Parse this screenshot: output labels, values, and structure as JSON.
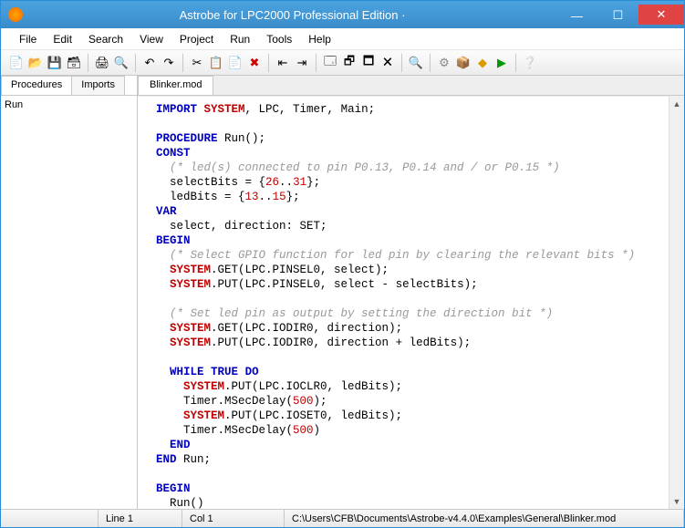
{
  "window": {
    "title": "Astrobe for LPC2000 Professional Edition  ·"
  },
  "menu": [
    "File",
    "Edit",
    "Search",
    "View",
    "Project",
    "Run",
    "Tools",
    "Help"
  ],
  "leftpanel": {
    "tabs": [
      "Procedures",
      "Imports"
    ],
    "items": [
      "Run"
    ]
  },
  "editor": {
    "tab": "Blinker.mod"
  },
  "code": {
    "l1a": "IMPORT",
    "l1b": "SYSTEM",
    "l1c": ", LPC, Timer, Main;",
    "l2a": "PROCEDURE",
    "l2b": " Run();",
    "l3": "CONST",
    "l4": "  (* led(s) connected to pin P0.13, P0.14 and / or P0.15 *)",
    "l5a": "  selectBits = {",
    "l5b": "26",
    "l5c": "..",
    "l5d": "31",
    "l5e": "};",
    "l6a": "  ledBits = {",
    "l6b": "13",
    "l6c": "..",
    "l6d": "15",
    "l6e": "};",
    "l7": "VAR",
    "l8": "  select, direction: SET;",
    "l9": "BEGIN",
    "l10": "  (* Select GPIO function for led pin by clearing the relevant bits *)",
    "l11a": "  ",
    "l11b": "SYSTEM",
    "l11c": ".GET(LPC.PINSEL0, select);",
    "l12a": "  ",
    "l12b": "SYSTEM",
    "l12c": ".PUT(LPC.PINSEL0, select - selectBits);",
    "l13": "  (* Set led pin as output by setting the direction bit *)",
    "l14a": "  ",
    "l14b": "SYSTEM",
    "l14c": ".GET(LPC.IODIR0, direction);",
    "l15a": "  ",
    "l15b": "SYSTEM",
    "l15c": ".PUT(LPC.IODIR0, direction + ledBits);",
    "l16a": "  ",
    "l16b": "WHILE",
    "l16c": " ",
    "l16d": "TRUE",
    "l16e": " ",
    "l16f": "DO",
    "l17a": "    ",
    "l17b": "SYSTEM",
    "l17c": ".PUT(LPC.IOCLR0, ledBits);",
    "l18a": "    Timer.MSecDelay(",
    "l18b": "500",
    "l18c": ");",
    "l19a": "    ",
    "l19b": "SYSTEM",
    "l19c": ".PUT(LPC.IOSET0, ledBits);",
    "l20a": "    Timer.MSecDelay(",
    "l20b": "500",
    "l20c": ")",
    "l21": "  ",
    "l21b": "END",
    "l22a": "END",
    "l22b": " Run;",
    "l23": "BEGIN",
    "l24": "  Run()"
  },
  "status": {
    "line": "Line 1",
    "col": "Col 1",
    "path": "C:\\Users\\CFB\\Documents\\Astrobe-v4.4.0\\Examples\\General\\Blinker.mod"
  },
  "icons": {
    "new": "📄",
    "open": "📂",
    "save": "💾",
    "saveall": "🗃",
    "print": "🖨",
    "preview": "🔍",
    "undo": "↶",
    "redo": "↷",
    "cut": "✂",
    "copy": "📋",
    "paste": "📄",
    "delete": "✖",
    "indent": "⇥",
    "outdent": "⇤",
    "w1": "🗔",
    "w2": "🗗",
    "w3": "🗖",
    "w4": "🗙",
    "find": "🔍",
    "gear": "⚙",
    "b1": "📦",
    "b2": "◆",
    "play": "▶",
    "help": "❔"
  }
}
